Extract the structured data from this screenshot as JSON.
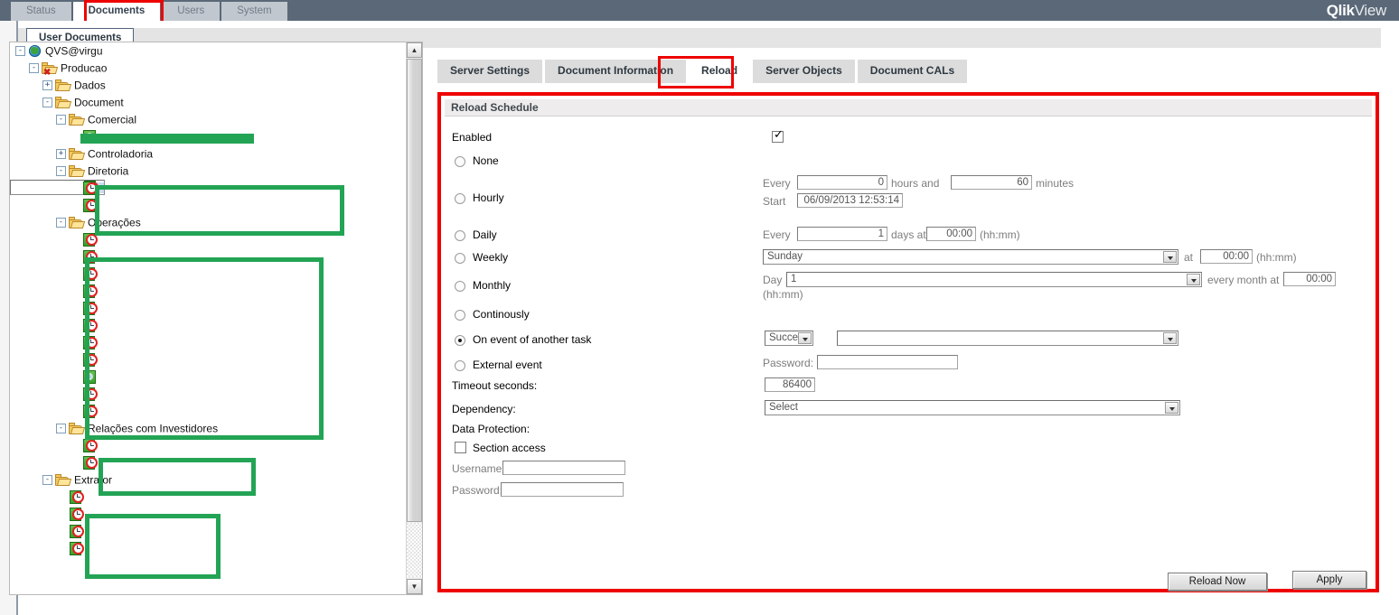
{
  "app": {
    "brand_bold": "Qlik",
    "brand_light": "View",
    "header_bg": "#5a6878",
    "highlight_color": "#ee0000",
    "redaction_color": "#23a455"
  },
  "main_tabs": [
    {
      "label": "Status",
      "active": false
    },
    {
      "label": "Documents",
      "active": true
    },
    {
      "label": "Users",
      "active": false
    },
    {
      "label": "System",
      "active": false
    }
  ],
  "sub_tab": {
    "label": "User Documents"
  },
  "tree": {
    "nodes": [
      {
        "label": "QVS@virgu",
        "indent": 0,
        "expander": "-",
        "icon": "globe-icon"
      },
      {
        "label": "Producao",
        "indent": 1,
        "expander": "-",
        "icon": "folder-error-icon"
      },
      {
        "label": "Dados",
        "indent": 2,
        "expander": "+",
        "icon": "folder-icon"
      },
      {
        "label": "Document",
        "indent": 2,
        "expander": "-",
        "icon": "folder-icon"
      },
      {
        "label": "Comercial",
        "indent": 3,
        "expander": "-",
        "icon": "folder-icon"
      },
      {
        "label": "",
        "indent": 4,
        "expander": "",
        "icon": "qvw-document-icon",
        "redacted": true
      },
      {
        "label": "Controladoria",
        "indent": 3,
        "expander": "+",
        "icon": "folder-icon"
      },
      {
        "label": "Diretoria",
        "indent": 3,
        "expander": "-",
        "icon": "folder-icon"
      },
      {
        "label": "",
        "indent": 4,
        "expander": "",
        "icon": "scheduled-task-icon",
        "redacted": true,
        "selected": true
      },
      {
        "label": "",
        "indent": 4,
        "expander": "",
        "icon": "scheduled-task-icon",
        "redacted": true
      },
      {
        "label": "",
        "indent": 4,
        "expander": "",
        "icon": "scheduled-task-icon",
        "redacted": true
      },
      {
        "label": "Operações",
        "indent": 3,
        "expander": "-",
        "icon": "folder-icon"
      },
      {
        "label": "",
        "indent": 4,
        "expander": "",
        "icon": "scheduled-task-icon",
        "redacted": true
      },
      {
        "label": "",
        "indent": 4,
        "expander": "",
        "icon": "scheduled-task-icon",
        "redacted": true
      },
      {
        "label": "",
        "indent": 4,
        "expander": "",
        "icon": "scheduled-task-icon",
        "redacted": true
      },
      {
        "label": "",
        "indent": 4,
        "expander": "",
        "icon": "scheduled-task-icon",
        "redacted": true
      },
      {
        "label": "",
        "indent": 4,
        "expander": "",
        "icon": "scheduled-task-icon",
        "redacted": true
      },
      {
        "label": "",
        "indent": 4,
        "expander": "",
        "icon": "scheduled-task-icon",
        "redacted": true
      },
      {
        "label": "",
        "indent": 4,
        "expander": "",
        "icon": "scheduled-task-icon",
        "redacted": true
      },
      {
        "label": "",
        "indent": 4,
        "expander": "",
        "icon": "scheduled-task-icon",
        "redacted": true
      },
      {
        "label": "",
        "indent": 4,
        "expander": "",
        "icon": "qvw-document-icon",
        "redacted": true
      },
      {
        "label": "",
        "indent": 4,
        "expander": "",
        "icon": "scheduled-task-icon",
        "redacted": true
      },
      {
        "label": "",
        "indent": 4,
        "expander": "",
        "icon": "scheduled-task-icon",
        "redacted": true
      },
      {
        "label": "Relações com Investidores",
        "indent": 3,
        "expander": "-",
        "icon": "folder-icon"
      },
      {
        "label": "",
        "indent": 4,
        "expander": "",
        "icon": "scheduled-task-icon",
        "redacted": true
      },
      {
        "label": "",
        "indent": 4,
        "expander": "",
        "icon": "scheduled-task-icon",
        "redacted": true
      },
      {
        "label": "Extrator",
        "indent": 2,
        "expander": "-",
        "icon": "folder-icon"
      },
      {
        "label": "",
        "indent": 3,
        "expander": "",
        "icon": "scheduled-task-icon",
        "redacted": true
      },
      {
        "label": "",
        "indent": 3,
        "expander": "",
        "icon": "scheduled-task-icon",
        "redacted": true
      },
      {
        "label": "",
        "indent": 3,
        "expander": "",
        "icon": "scheduled-task-icon",
        "redacted": true
      },
      {
        "label": "",
        "indent": 3,
        "expander": "",
        "icon": "scheduled-task-icon",
        "redacted": true
      }
    ]
  },
  "content_tabs": [
    {
      "label": "Server Settings",
      "active": false
    },
    {
      "label": "Document Information",
      "active": false
    },
    {
      "label": "Reload",
      "active": true
    },
    {
      "label": "Server Objects",
      "active": false
    },
    {
      "label": "Document CALs",
      "active": false
    }
  ],
  "reload": {
    "panel_title": "Reload Schedule",
    "enabled_label": "Enabled",
    "enabled_checked": true,
    "schedule_options": [
      {
        "label": "None",
        "selected": false
      },
      {
        "label": "Hourly",
        "selected": false
      },
      {
        "label": "Daily",
        "selected": false
      },
      {
        "label": "Weekly",
        "selected": false
      },
      {
        "label": "Monthly",
        "selected": false
      },
      {
        "label": "Continously",
        "selected": false
      },
      {
        "label": "On event of another task",
        "selected": true
      },
      {
        "label": "External event",
        "selected": false
      }
    ],
    "hourly": {
      "every_label": "Every",
      "hours_value": "0",
      "hours_unit_label": "hours and",
      "minutes_value": "60",
      "minutes_unit_label": "minutes",
      "start_label": "Start",
      "start_value": "06/09/2013 12:53:14"
    },
    "daily": {
      "every_label": "Every",
      "days_value": "1",
      "days_at_label": "days at",
      "time_value": "00:00",
      "hhmm_label": "(hh:mm)"
    },
    "weekly": {
      "day_value": "Sunday",
      "at_label": "at",
      "time_value": "00:00",
      "hhmm_label": "(hh:mm)"
    },
    "monthly": {
      "day_label": "Day",
      "day_value": "1",
      "every_month_label": "every month at",
      "time_value": "00:00",
      "hhmm_label": "(hh:mm)"
    },
    "on_event": {
      "condition_value": "Succe:",
      "task_value": "",
      "password_label": "Password:",
      "password_value": ""
    },
    "timeout_label": "Timeout seconds:",
    "timeout_value": "86400",
    "dependency_label": "Dependency:",
    "dependency_value": "Select",
    "data_protection_label": "Data Protection:",
    "section_access_label": "Section access",
    "section_access_checked": false,
    "username_label": "Username:",
    "username_value": "",
    "password_label": "Password:",
    "password_value": "",
    "reload_now_button": "Reload Now",
    "apply_button": "Apply"
  }
}
